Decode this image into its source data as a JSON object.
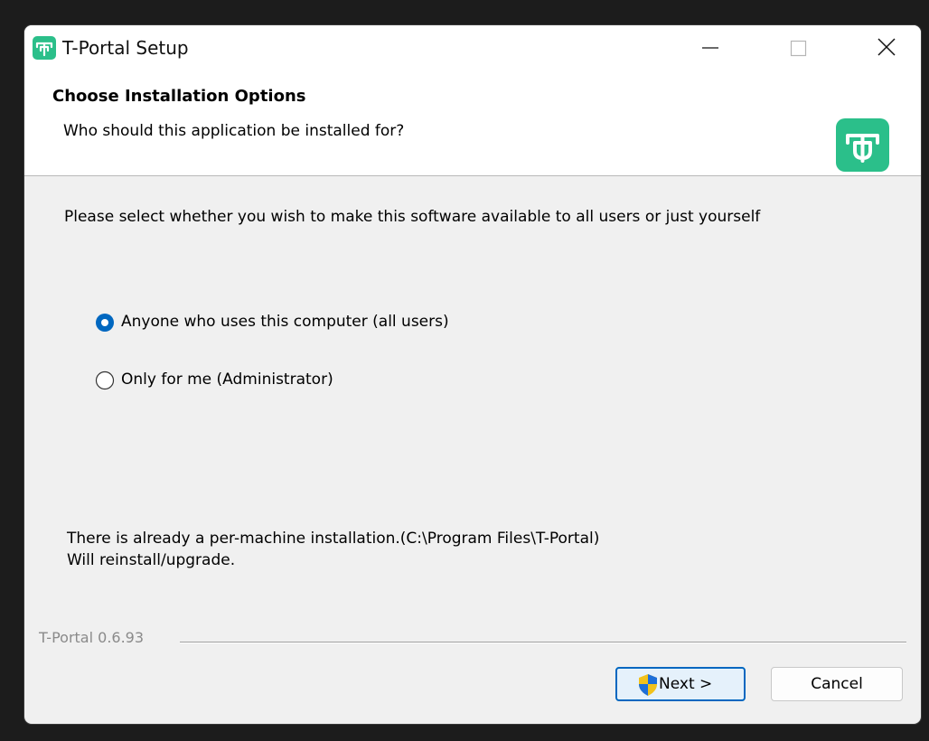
{
  "window": {
    "title": "T-Portal Setup",
    "icon": "t-portal-logo-icon"
  },
  "controls": {
    "minimize_icon": "minimize-icon",
    "maximize_icon": "maximize-icon",
    "close_icon": "close-icon"
  },
  "header": {
    "title": "Choose Installation Options",
    "subtitle": "Who should this application be installed for?",
    "logo_icon": "t-portal-logo-icon"
  },
  "body": {
    "instruction": "Please select whether you wish to make this software available to all users or just yourself",
    "options": [
      {
        "label": "Anyone who uses this computer (all users)",
        "selected": true
      },
      {
        "label": "Only for me (Administrator)",
        "selected": false
      }
    ],
    "notice_line1": "There is already a per-machine installation.(C:\\Program Files\\T-Portal)",
    "notice_line2": "Will reinstall/upgrade."
  },
  "footer": {
    "brand_text": "T-Portal 0.6.93",
    "next_label": "Next >",
    "next_icon": "uac-shield-icon",
    "cancel_label": "Cancel"
  },
  "colors": {
    "brand_green": "#2bbf8a",
    "accent_blue": "#0067c0",
    "window_bg": "#f0f0f0",
    "header_bg": "#ffffff"
  }
}
